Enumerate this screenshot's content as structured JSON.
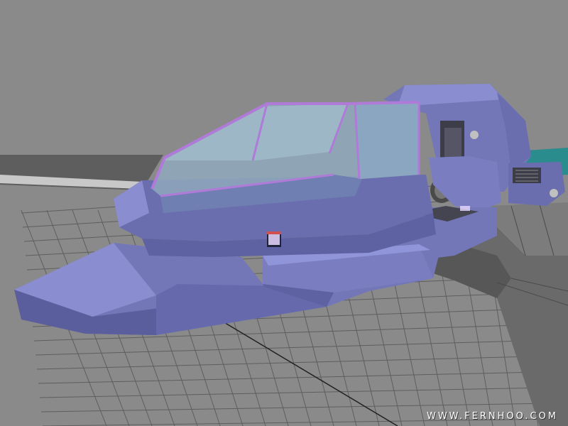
{
  "viewport": {
    "background_color": "#8a8a8a",
    "grid_color": "#5e5e5e",
    "grid_major_color": "#222222"
  },
  "model": {
    "hull_color": "#7377b8",
    "hull_light_color": "#8a8ed0",
    "hull_dark_color": "#5a5e9c",
    "canopy_frame_color": "#b07ad8",
    "canopy_glass_color": "#8fa9bc",
    "wing_color": "#5a5a5a",
    "teal_accent_color": "#2a8c8c",
    "screen_color": "#e9d8ff"
  },
  "watermark": {
    "text": "WWW.FERNHOO.COM"
  }
}
